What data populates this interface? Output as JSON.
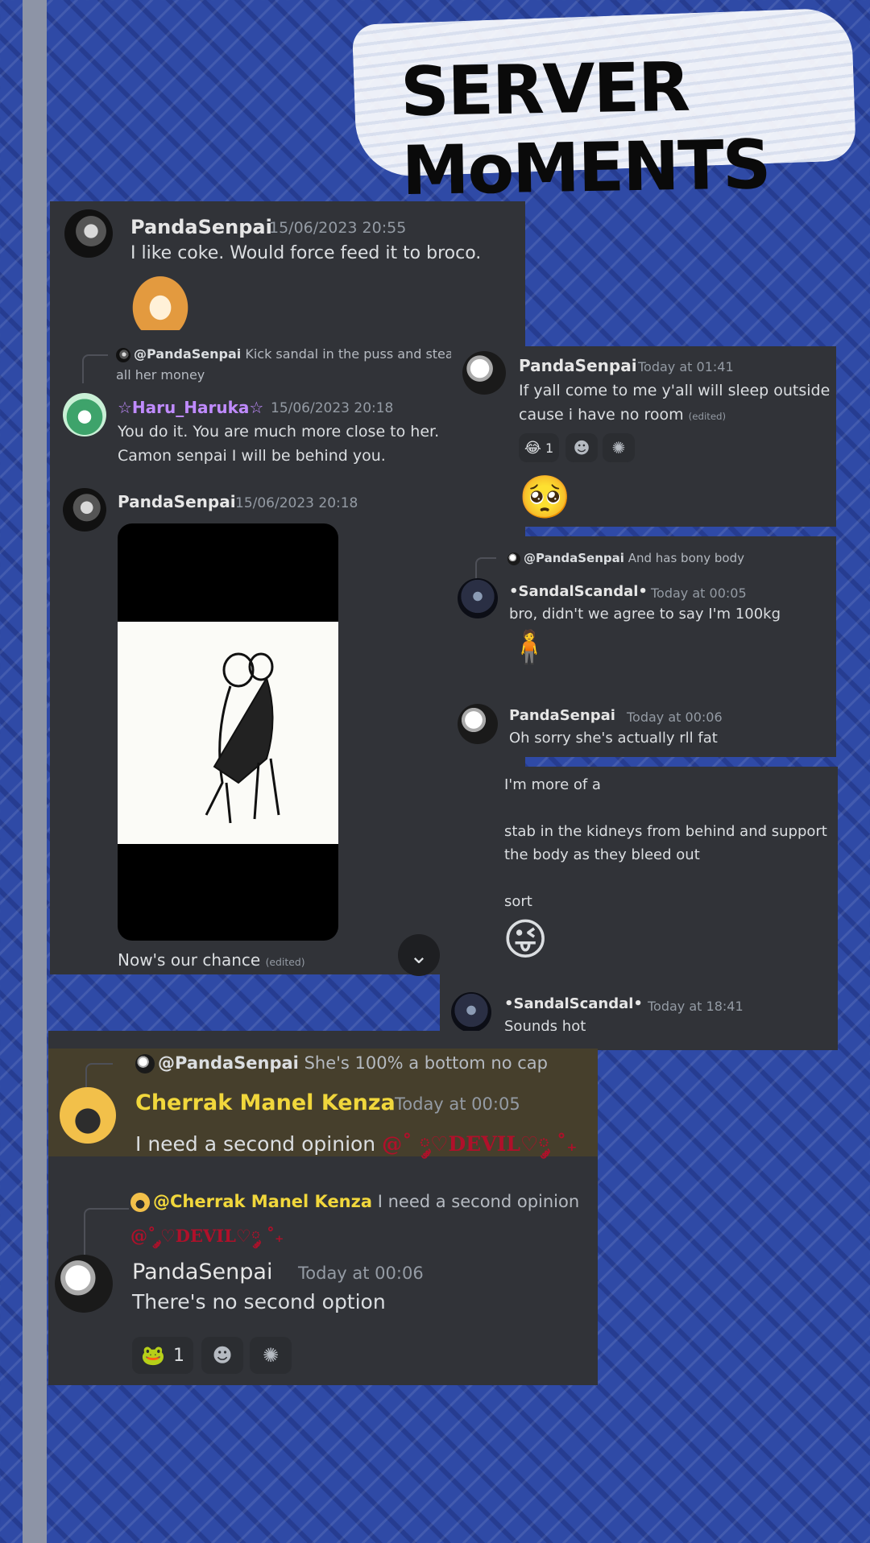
{
  "title": "SERVER MoMENTS",
  "colors": {
    "background": "#2f4aa6",
    "panel": "#313338",
    "highlight": "#463f2c",
    "haru_name": "#c08bff",
    "cherrak_name": "#f1d73c",
    "devil": "#b0102a"
  },
  "card1": {
    "user": "PandaSenpai",
    "time": "15/06/2023 20:55",
    "text": "I like coke. Would force feed it to broco."
  },
  "card2": {
    "reply_user": "@PandaSenpai",
    "reply_text_1": "Kick sandal in the puss and steal",
    "reply_text_2": "all her money",
    "user": "☆Haru_Haruka☆",
    "time": "15/06/2023 20:18",
    "line1": "You do it. You are much more close to her.",
    "line2": "Camon senpai I will be behind you."
  },
  "card3": {
    "user": "PandaSenpai",
    "time": "15/06/2023 20:18",
    "caption": "Now's our chance",
    "edited": "(edited)",
    "scroll_icon": "chevron-down-icon"
  },
  "card4": {
    "user": "PandaSenpai",
    "time": "Today at 01:41",
    "line1": "If yall come to me y'all will sleep outside",
    "line2": "cause i have no room",
    "edited": "(edited)",
    "reaction_count": "1"
  },
  "card5": {
    "reply_user": "@PandaSenpai",
    "reply_text": "And has bony body",
    "user": "•SandalScandal•",
    "time": "Today at 00:05",
    "text": "bro, didn't we agree to say I'm 100kg",
    "user2": "PandaSenpai",
    "time2": "Today at 00:06",
    "text2": "Oh sorry she's actually rll fat"
  },
  "card6": {
    "line1": "I'm more of a",
    "line2": "stab in the kidneys from behind and support",
    "line3": "the body as they bleed out",
    "line4": "sort",
    "user": "•SandalScandal•",
    "time": "Today at 18:41",
    "text": "Sounds hot"
  },
  "card7": {
    "reply_user": "@PandaSenpai",
    "reply_text": "She's 100% a bottom no cap",
    "user": "Cherrak Manel Kenza",
    "time": "Today at 00:05",
    "text": "I need a second opinion",
    "mention": "@˚ ༘♡DEVIL♡༘ ˚₊",
    "reply2_user": "@Cherrak Manel Kenza",
    "reply2_text": "I need a second opinion",
    "reply2_mention": "@˚ ༘♡DEVIL♡༘ ˚₊",
    "user2": "PandaSenpai",
    "time2": "Today at 00:06",
    "text2": "There's no second option",
    "reaction_count": "1"
  }
}
